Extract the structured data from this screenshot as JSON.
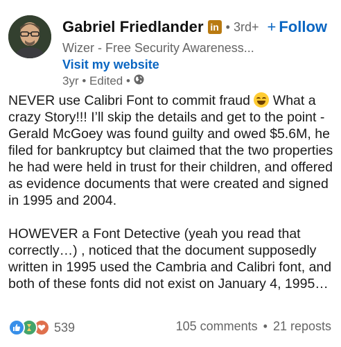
{
  "author": {
    "name": "Gabriel Friedlander",
    "badge": "in",
    "degree": "3rd+",
    "follow_label": "Follow",
    "headline": "Wizer - Free Security Awareness...",
    "website_label": "Visit my website",
    "age": "3yr",
    "edited": "Edited",
    "icons": {
      "badge": "linkedin-badge-icon",
      "visibility": "globe-icon"
    }
  },
  "post": {
    "p1_before_emoji": "NEVER use Calibri Font to commit fraud",
    "p1_after_emoji": "What a crazy Story!!! I’ll skip the details and get to the point -  Gerald McGoey was found guilty and owed $5.6M, he filed for bankruptcy but claimed that the two properties he had were held in trust for their children, and offered as evidence documents that were created and signed in 1995 and 2004.",
    "p2": "HOWEVER a Font Detective (yeah you read that correctly…) , noticed that the document supposedly written in 1995 used the Cambria and Calibri font, and both of these fonts did not exist on January 4, 1995…"
  },
  "social": {
    "reaction_icons": [
      "like-icon",
      "celebrate-icon",
      "love-icon"
    ],
    "reaction_count": "539",
    "comments": "105 comments",
    "reposts": "21 reposts"
  },
  "colors": {
    "accent": "#0a66c2",
    "muted": "#666666",
    "badge": "#b97a11"
  }
}
